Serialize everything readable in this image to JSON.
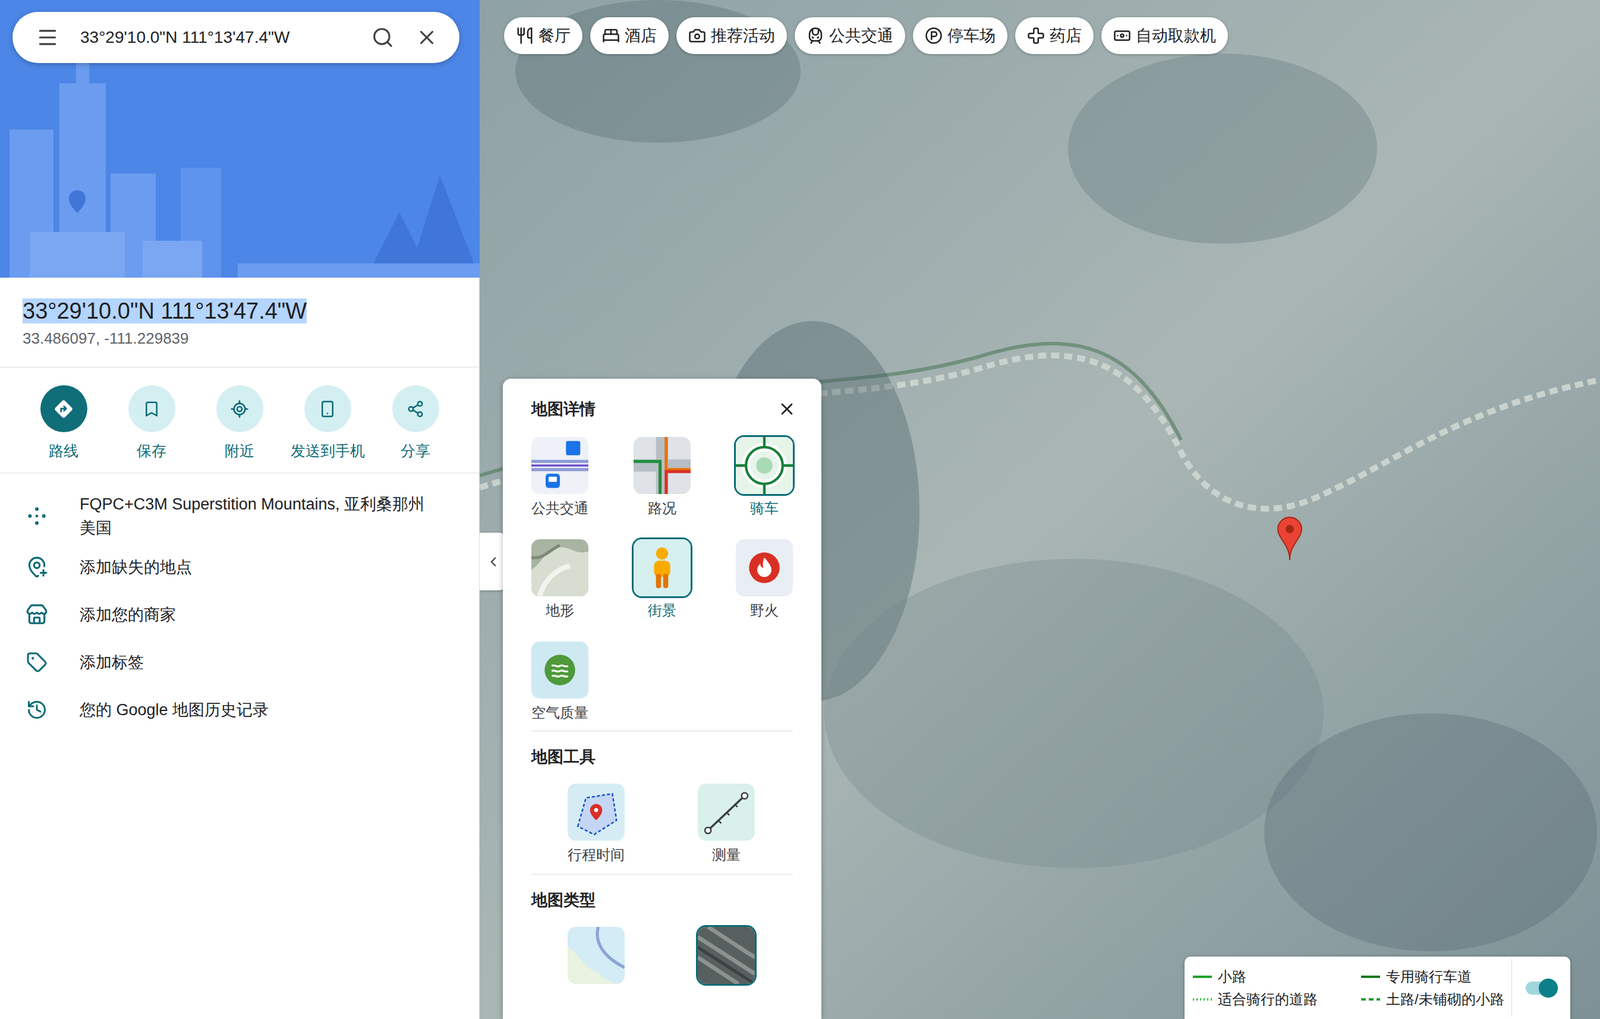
{
  "search": {
    "query": "33°29'10.0\"N 111°13'47.4\"W"
  },
  "place": {
    "title": "33°29'10.0\"N 111°13'47.4\"W",
    "title_selected": true,
    "decimal": "33.486097, -111.229839"
  },
  "actions": [
    {
      "label": "路线",
      "kind": "directions",
      "primary": true
    },
    {
      "label": "保存",
      "kind": "save",
      "primary": false
    },
    {
      "label": "附近",
      "kind": "nearby",
      "primary": false
    },
    {
      "label": "发送到手机",
      "kind": "send",
      "primary": false
    },
    {
      "label": "分享",
      "kind": "share",
      "primary": false
    }
  ],
  "details": [
    {
      "kind": "pluscode",
      "lines": [
        "FQPC+C3M Superstition Mountains, 亚利桑那州",
        "美国"
      ]
    },
    {
      "kind": "add-place",
      "lines": [
        "添加缺失的地点"
      ]
    },
    {
      "kind": "add-business",
      "lines": [
        "添加您的商家"
      ]
    },
    {
      "kind": "label",
      "lines": [
        "添加标签"
      ]
    },
    {
      "kind": "history",
      "lines": [
        "您的 Google 地图历史记录"
      ]
    }
  ],
  "chips": [
    {
      "label": "餐厅",
      "kind": "restaurant"
    },
    {
      "label": "酒店",
      "kind": "hotel"
    },
    {
      "label": "推荐活动",
      "kind": "activities"
    },
    {
      "label": "公共交通",
      "kind": "transit"
    },
    {
      "label": "停车场",
      "kind": "parking"
    },
    {
      "label": "药店",
      "kind": "pharmacy"
    },
    {
      "label": "自动取款机",
      "kind": "atm"
    }
  ],
  "layers_panel": {
    "title": "地图详情",
    "details": [
      {
        "label": "公共交通",
        "kind": "transit",
        "selected": false
      },
      {
        "label": "路况",
        "kind": "traffic",
        "selected": false
      },
      {
        "label": "骑车",
        "kind": "bicycling",
        "selected": true
      },
      {
        "label": "地形",
        "kind": "terrain",
        "selected": false
      },
      {
        "label": "街景",
        "kind": "streetview",
        "selected": true
      },
      {
        "label": "野火",
        "kind": "wildfire",
        "selected": false
      },
      {
        "label": "空气质量",
        "kind": "airquality",
        "selected": false
      }
    ],
    "tools_title": "地图工具",
    "tools": [
      {
        "label": "行程时间",
        "kind": "traveltime"
      },
      {
        "label": "测量",
        "kind": "measure"
      }
    ],
    "types_title": "地图类型",
    "types": [
      {
        "kind": "default",
        "selected": false
      },
      {
        "kind": "satellite",
        "selected": true
      }
    ]
  },
  "legend": {
    "items": [
      {
        "label": "小路",
        "style": "solid",
        "color": "#1fa32a"
      },
      {
        "label": "适合骑行的道路",
        "style": "dotted",
        "color": "#2fbf3a"
      },
      {
        "label": "专用骑行车道",
        "style": "solid",
        "color": "#137a1c"
      },
      {
        "label": "土路/未铺砌的小路",
        "style": "dashed",
        "color": "#2a9a33"
      }
    ],
    "toggle_on": true
  },
  "pin": {
    "color": "#ea4335"
  }
}
